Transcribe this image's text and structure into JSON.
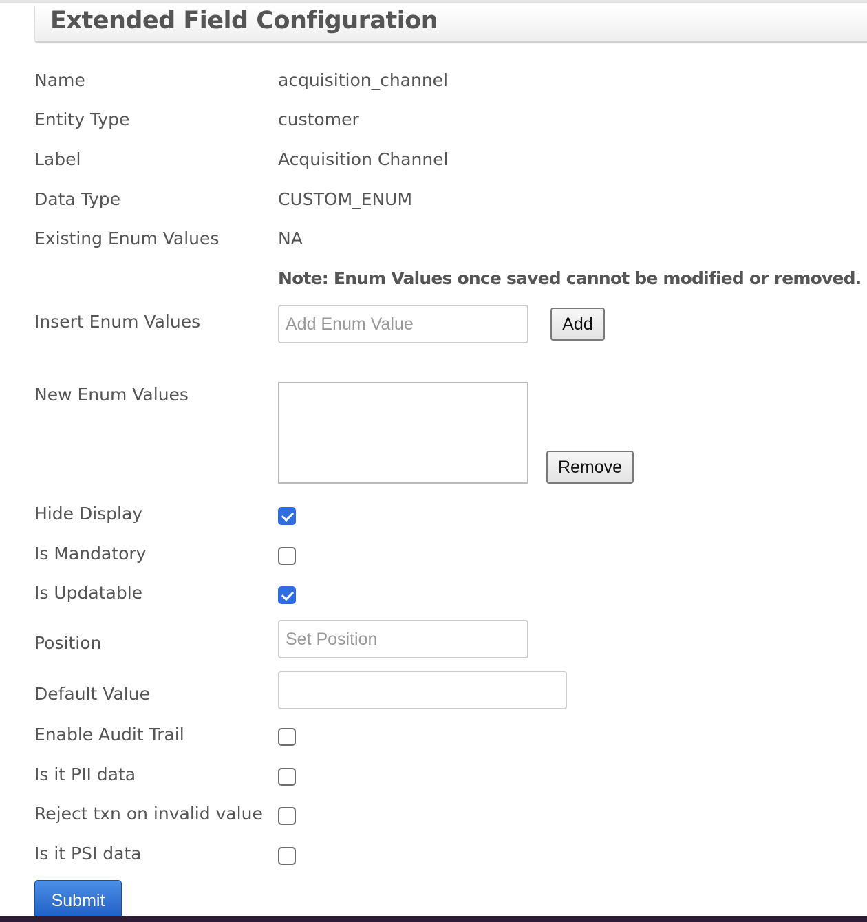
{
  "header": {
    "title": "Extended Field Configuration"
  },
  "fields": {
    "name": {
      "label": "Name",
      "value": "acquisition_channel"
    },
    "entity_type": {
      "label": "Entity Type",
      "value": "customer"
    },
    "label": {
      "label": "Label",
      "value": "Acquisition Channel"
    },
    "data_type": {
      "label": "Data Type",
      "value": "CUSTOM_ENUM"
    },
    "existing_enum_values": {
      "label": "Existing Enum Values",
      "value": "NA"
    }
  },
  "note": "Note: Enum Values once saved cannot be modified or removed.",
  "insert_enum": {
    "label": "Insert Enum Values",
    "placeholder": "Add Enum Value",
    "value": "",
    "add_label": "Add"
  },
  "new_enum": {
    "label": "New Enum Values",
    "items": [],
    "remove_label": "Remove"
  },
  "checkboxes": {
    "hide_display": {
      "label": "Hide Display",
      "checked": true
    },
    "is_mandatory": {
      "label": "Is Mandatory",
      "checked": false
    },
    "is_updatable": {
      "label": "Is Updatable",
      "checked": true
    },
    "enable_audit_trail": {
      "label": "Enable Audit Trail",
      "checked": false
    },
    "is_pii": {
      "label": "Is it PII data",
      "checked": false
    },
    "reject_txn": {
      "label": "Reject txn on invalid value",
      "checked": false
    },
    "is_psi": {
      "label": "Is it PSI data",
      "checked": false
    }
  },
  "position": {
    "label": "Position",
    "placeholder": "Set Position",
    "value": ""
  },
  "default_value": {
    "label": "Default Value",
    "value": ""
  },
  "submit_label": "Submit",
  "colors": {
    "primary": "#2f6de1",
    "text": "#555555",
    "submit": "#1e5cc5"
  }
}
